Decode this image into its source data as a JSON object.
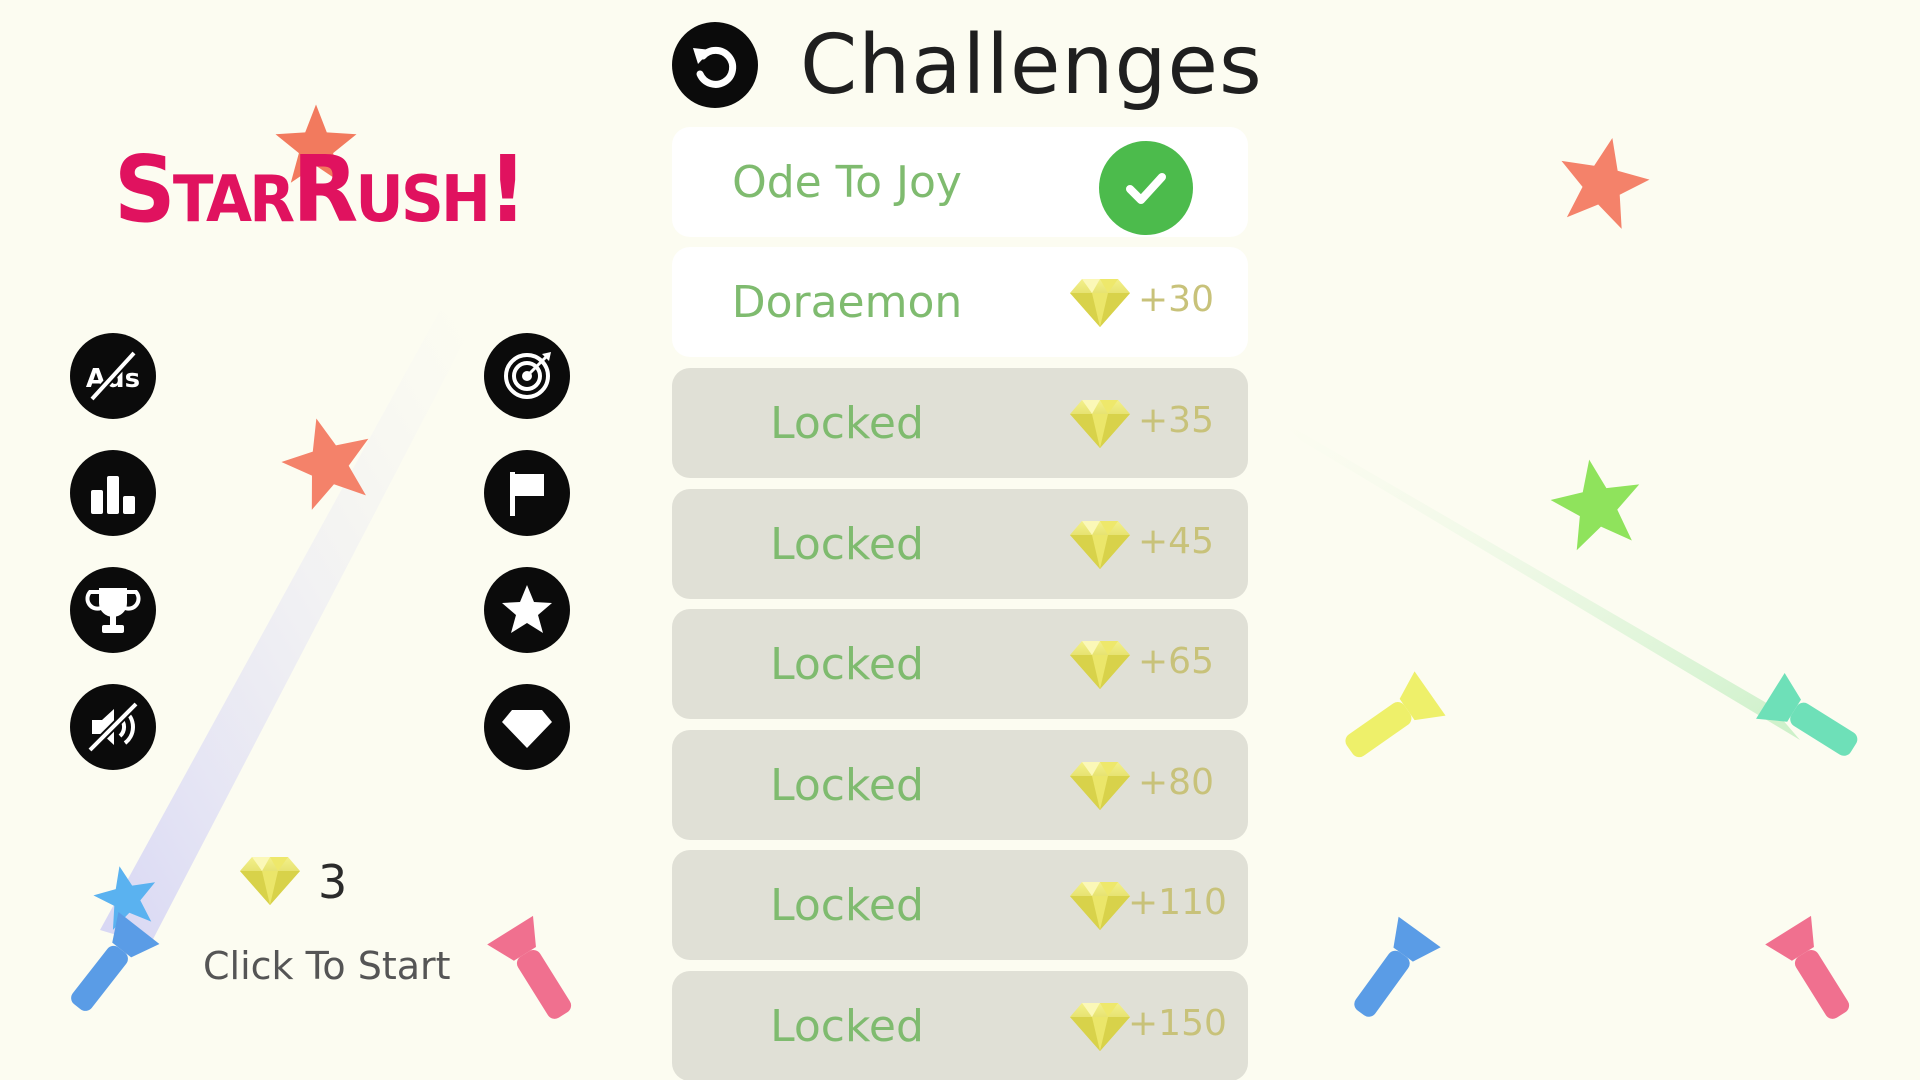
{
  "header": {
    "title": "Challenges"
  },
  "logo": {
    "text": "StarRush!"
  },
  "left_buttons": [
    {
      "name": "no-ads-icon"
    },
    {
      "name": "leaderboard-icon"
    },
    {
      "name": "trophy-icon"
    },
    {
      "name": "sound-off-icon"
    }
  ],
  "right_buttons": [
    {
      "name": "target-icon"
    },
    {
      "name": "flag-icon"
    },
    {
      "name": "star-icon"
    },
    {
      "name": "diamond-icon"
    }
  ],
  "challenges": [
    {
      "name": "Ode To Joy",
      "status": "completed",
      "reward": ""
    },
    {
      "name": "Doraemon",
      "status": "unlocked",
      "reward": "+30"
    },
    {
      "name": "Locked",
      "status": "locked",
      "reward": "+35"
    },
    {
      "name": "Locked",
      "status": "locked",
      "reward": "+45"
    },
    {
      "name": "Locked",
      "status": "locked",
      "reward": "+65"
    },
    {
      "name": "Locked",
      "status": "locked",
      "reward": "+80"
    },
    {
      "name": "Locked",
      "status": "locked",
      "reward": "+110"
    },
    {
      "name": "Locked",
      "status": "locked",
      "reward": "+150"
    }
  ],
  "player": {
    "gems": "3",
    "start_label": "Click To Start"
  },
  "colors": {
    "background": "#fcfcf1",
    "logo": "#e0125f",
    "challenge_text": "#7fbb6f",
    "reward_text": "#c8c27a",
    "check": "#4cbb4c",
    "locked_row": "#e0e0d6"
  }
}
